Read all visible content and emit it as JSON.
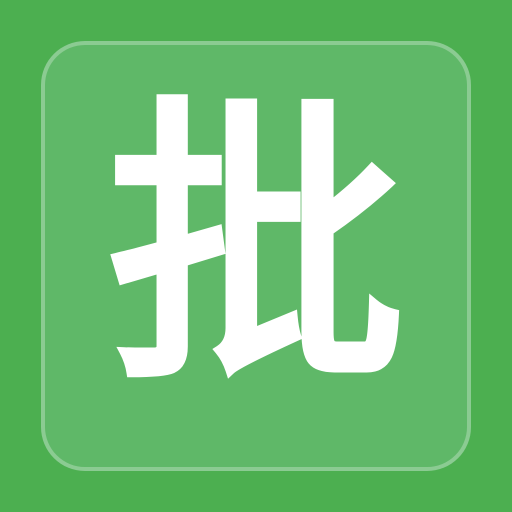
{
  "icon": {
    "character": "批",
    "background_color": "#4CAF50",
    "tile_color": "#5FB868",
    "glyph_color": "#FFFFFF"
  }
}
